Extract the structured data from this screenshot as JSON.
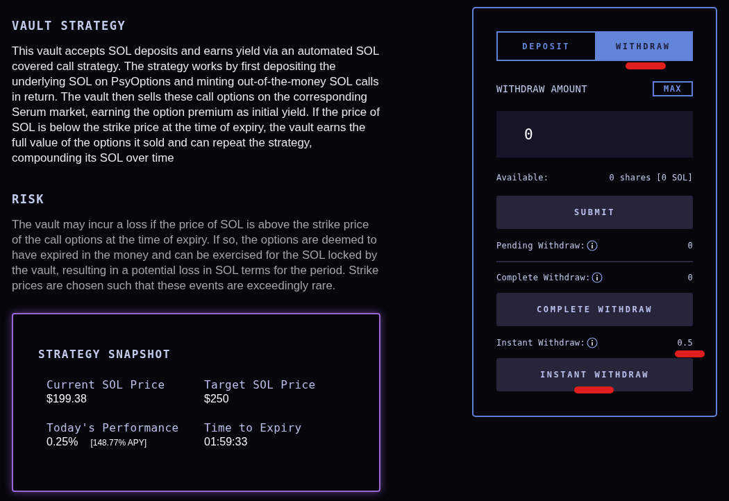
{
  "sections": [
    {
      "heading": "VAULT STRATEGY",
      "dimmed": false,
      "text": "This vault accepts SOL deposits and earns yield via an automated SOL covered call strategy. The strategy works by first depositing the underlying SOL on PsyOptions and minting out-of-the-money SOL calls in return. The vault then sells these call options on the corresponding Serum market, earning the option premium as initial yield. If the price of SOL is below the strike price at the time of expiry, the vault earns the full value of the options it sold and can repeat the strategy, compounding its SOL over time"
    },
    {
      "heading": "RISK",
      "dimmed": true,
      "text": "The vault may incur a loss if the price of SOL is above the strike price of the call options at the time of expiry. If so, the options are deemed to have expired in the money and can be exercised for the SOL locked by the vault, resulting in a potential loss in SOL terms for the period. Strike prices are chosen such that these events are exceedingly rare."
    }
  ],
  "snapshot": {
    "title": "STRATEGY SNAPSHOT",
    "stats": [
      {
        "label": "Current SOL Price",
        "value": "$199.38"
      },
      {
        "label": "Target SOL Price",
        "value": "$250"
      },
      {
        "label": "Today's Performance",
        "value": "0.25%",
        "note": "[148.77% APY]"
      },
      {
        "label": "Time to Expiry",
        "value": "01:59:33"
      }
    ]
  },
  "panel": {
    "tabs": [
      {
        "label": "DEPOSIT",
        "selected": false
      },
      {
        "label": "WITHDRAW",
        "selected": true
      }
    ],
    "amount_label": "WITHDRAW AMOUNT",
    "max_button": "MAX",
    "amount_value": "0",
    "available": {
      "label": "Available:",
      "value": "0 shares [0 SOL]"
    },
    "items": [
      {
        "kind": "button",
        "label": "SUBMIT"
      },
      {
        "kind": "stat",
        "label": "Pending Withdraw:",
        "value": "0",
        "divided": true
      },
      {
        "kind": "stat",
        "label": "Complete Withdraw:",
        "value": "0",
        "divided": false
      },
      {
        "kind": "button",
        "label": "COMPLETE WITHDRAW"
      },
      {
        "kind": "stat",
        "label": "Instant Withdraw:",
        "value": "0.5",
        "divided": false
      },
      {
        "kind": "button",
        "label": "INSTANT WITHDRAW"
      }
    ]
  }
}
